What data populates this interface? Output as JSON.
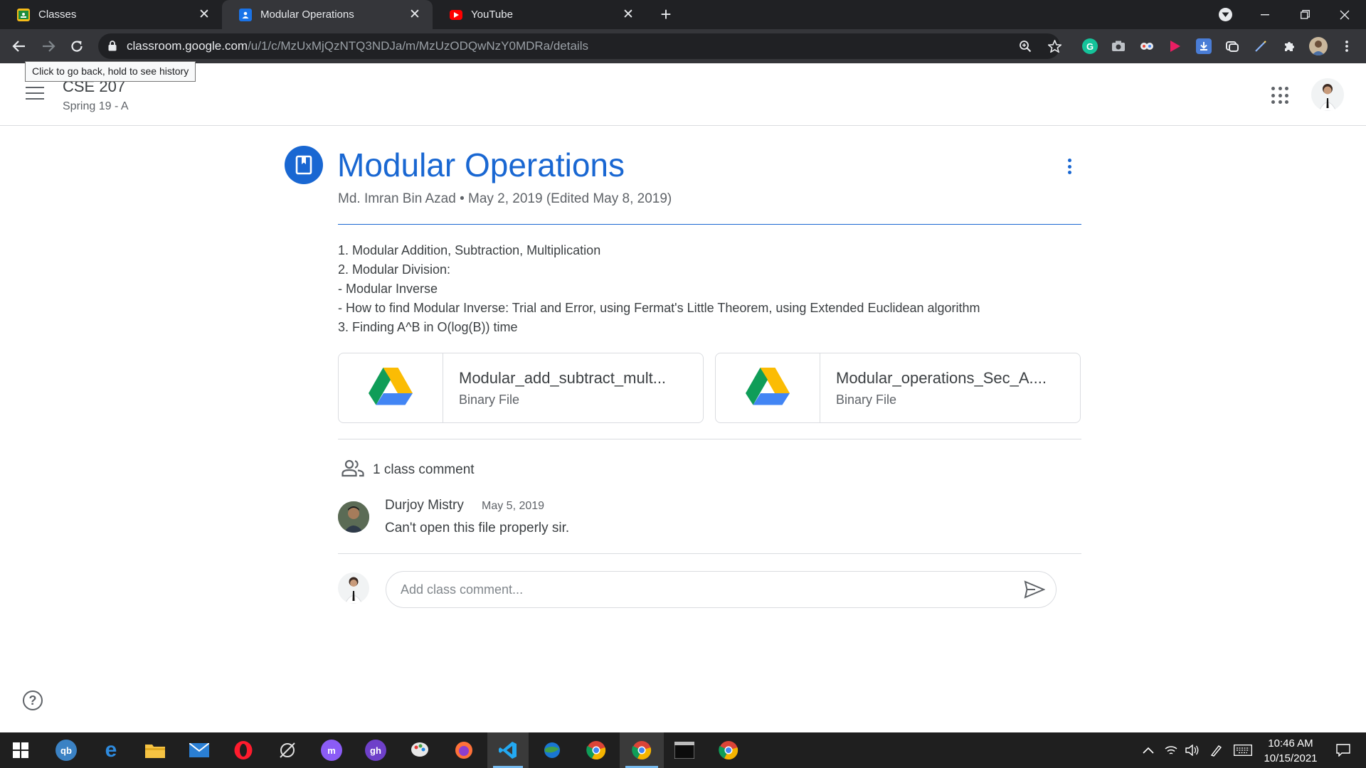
{
  "browser": {
    "tabs": [
      {
        "title": "Classes",
        "active": false
      },
      {
        "title": "Modular Operations",
        "active": true
      },
      {
        "title": "YouTube",
        "active": false
      }
    ],
    "url_host": "classroom.google.com",
    "url_path": "/u/1/c/MzUxMjQzNTQ3NDJa/m/MzUzODQwNzY0MDRa/details",
    "back_tooltip": "Click to go back, hold to see history"
  },
  "header": {
    "class_name": "CSE 207",
    "section": "Spring 19 - A"
  },
  "post": {
    "title": "Modular Operations",
    "meta": "Md. Imran Bin Azad • May 2, 2019 (Edited May 8, 2019)",
    "description": [
      "1. Modular Addition, Subtraction, Multiplication",
      "2. Modular Division:",
      "- Modular Inverse",
      "- How to find Modular Inverse: Trial and Error, using Fermat's Little Theorem, using Extended Euclidean algorithm",
      "3. Finding A^B in O(log(B)) time"
    ],
    "attachments": [
      {
        "name": "Modular_add_subtract_mult...",
        "type": "Binary File",
        "icon": "google-drive-icon"
      },
      {
        "name": "Modular_operations_Sec_A....",
        "type": "Binary File",
        "icon": "google-drive-icon"
      }
    ]
  },
  "comments": {
    "count_label": "1 class comment",
    "items": [
      {
        "author": "Durjoy Mistry",
        "date": "May 5, 2019",
        "text": "Can't open this file properly sir."
      }
    ],
    "input_placeholder": "Add class comment..."
  },
  "taskbar": {
    "time": "10:46 AM",
    "date": "10/15/2021"
  },
  "colors": {
    "accent": "#1967d2",
    "chrome_dark": "#202124",
    "chrome_toolbar": "#35363a",
    "taskbar": "#1f1f1f"
  }
}
